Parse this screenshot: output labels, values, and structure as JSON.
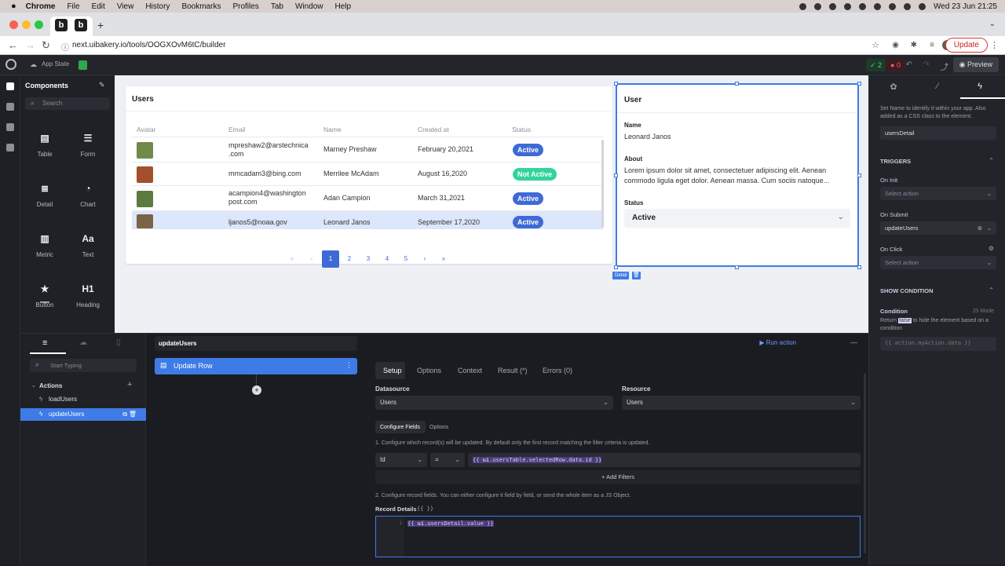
{
  "menubar": {
    "app": "Chrome",
    "items": [
      "File",
      "Edit",
      "View",
      "History",
      "Bookmarks",
      "Profiles",
      "Tab",
      "Window",
      "Help"
    ],
    "datetime": "Wed 23 Jun  21:25"
  },
  "browser": {
    "url": "next.uibakery.io/tools/OOGXOvM6tC/builder",
    "update_label": "Update"
  },
  "appbar": {
    "app_state": "App State",
    "success_count": "2",
    "error_count": "0",
    "preview_label": "Preview"
  },
  "components": {
    "title": "Components",
    "search_placeholder": "Search",
    "items": [
      {
        "label": "Table",
        "icon": "table-icon"
      },
      {
        "label": "Form",
        "icon": "form-icon"
      },
      {
        "label": "Detail",
        "icon": "detail-icon"
      },
      {
        "label": "Chart",
        "icon": "chart-icon"
      },
      {
        "label": "Metric",
        "icon": "metric-icon"
      },
      {
        "label": "Text",
        "icon": "text-icon"
      },
      {
        "label": "Button",
        "icon": "button-icon"
      },
      {
        "label": "Heading",
        "icon": "heading-icon"
      }
    ]
  },
  "users_table": {
    "title": "Users",
    "columns": [
      "Avatar",
      "Email",
      "Name",
      "Created at",
      "Status"
    ],
    "rows": [
      {
        "email_line1": "mpreshaw2@arstechnica",
        "email_line2": ".com",
        "name": "Marney Preshaw",
        "created": "February 20,2021",
        "status": "Active",
        "avatar_color": "#6f8a4a"
      },
      {
        "email_line1": "mmcadam3@bing.com",
        "email_line2": "",
        "name": "Merrilee McAdam",
        "created": "August 16,2020",
        "status": "Not Active",
        "avatar_color": "#a4502c"
      },
      {
        "email_line1": "acampion4@washington",
        "email_line2": "post.com",
        "name": "Adan Campion",
        "created": "March 31,2021",
        "status": "Active",
        "avatar_color": "#5d7b3e"
      },
      {
        "email_line1": "ljanos5@noaa.gov",
        "email_line2": "",
        "name": "Leonard Janos",
        "created": "September 17,2020",
        "status": "Active",
        "avatar_color": "#7a6448"
      }
    ],
    "pagination": [
      "«",
      "‹",
      "1",
      "2",
      "3",
      "4",
      "5",
      "›",
      "»"
    ],
    "current_page": "1"
  },
  "detail": {
    "title": "User",
    "name_label": "Name",
    "name_value": "Leonard Janos",
    "about_label": "About",
    "about_line1": "Lorem ipsum dolor sit amet, consectetuer adipiscing elit. Aenean",
    "about_line2": "commodo ligula eget dolor. Aenean massa. Cum sociis natoque...",
    "status_label": "Status",
    "status_value": "Active",
    "tag_label": "Detail"
  },
  "props": {
    "help_text": "Set Name to identify it within your app. Also added as a CSS class to the element.",
    "name_value": "usersDetail",
    "triggers_label": "TRIGGERS",
    "on_init_label": "On Init",
    "on_init_value": "Select action",
    "on_submit_label": "On Submit",
    "on_submit_value": "updateUsers",
    "on_click_label": "On Click",
    "on_click_value": "Select action",
    "show_condition_label": "SHOW CONDITION",
    "condition_label": "Condition",
    "js_mode_label": "JS Mode",
    "condition_help_pre": "Return ",
    "condition_help_kw": "false",
    "condition_help_post": " to hide the element based on a condition",
    "condition_placeholder": "{{ action.myAction.data }}"
  },
  "actions": {
    "search_placeholder": "Start Typing",
    "section_label": "Actions",
    "items": [
      "loadUsers",
      "updateUsers"
    ],
    "selected": "updateUsers"
  },
  "action_editor": {
    "name": "updateUsers",
    "step_label": "Update Row",
    "run_label": "Run action",
    "tabs": [
      "Setup",
      "Options",
      "Context",
      "Result (*)",
      "Errors (0)"
    ],
    "datasource_label": "Datasource",
    "datasource_value": "Users",
    "resource_label": "Resource",
    "resource_value": "Users",
    "subtabs": [
      "Configure Fields",
      "Options"
    ],
    "step1_text": "1. Configure which record(s) will be updated. By default only the first record matching the filter criteria is updated.",
    "filter_field": "Id",
    "filter_op": "=",
    "filter_value_pre": "{{ ",
    "filter_value_ui": "ui",
    "filter_value_rest": ".usersTable.selectedRow.data.id ",
    "filter_value_post": "}}",
    "add_filters_label": "Add Filters",
    "step2_text": "2. Configure record fields. You can either configure it field by field, or send the whole item as a JS Object.",
    "record_details_label": "Record Details",
    "record_details_tag": "{{ }}",
    "line_number": "1",
    "record_code_pre": "{{ ",
    "record_code_ui": "ui",
    "record_code_rest": ".usersDetail.value",
    "record_code_post": " }}"
  }
}
